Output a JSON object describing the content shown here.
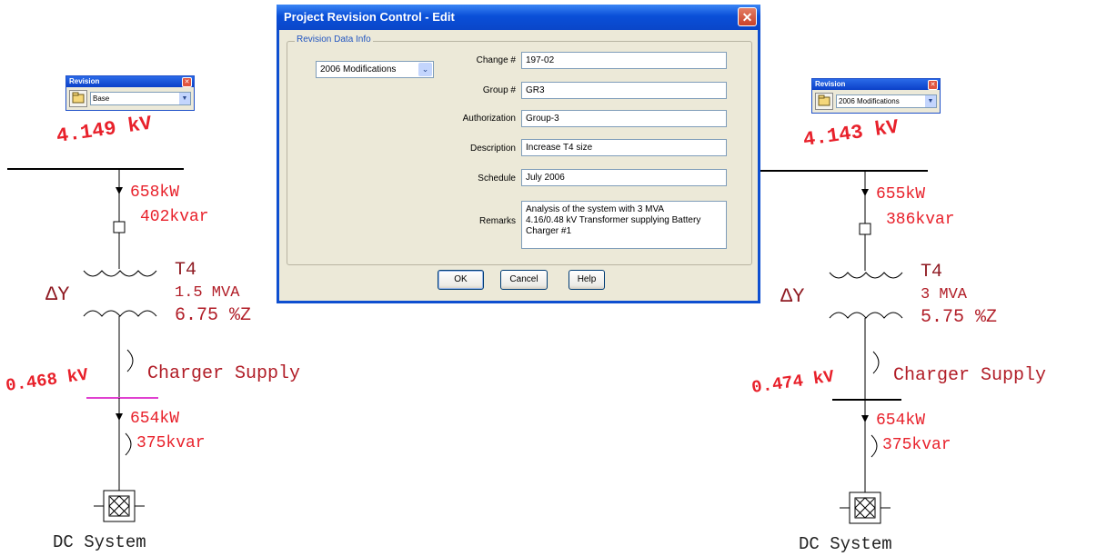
{
  "dialog": {
    "title": "Project Revision Control - Edit",
    "group_label": "Revision Data Info",
    "revision_select": "2006 Modifications",
    "fields": {
      "change": {
        "label": "Change #",
        "value": "197-02"
      },
      "group": {
        "label": "Group #",
        "value": "GR3"
      },
      "authorization": {
        "label": "Authorization",
        "value": "Group-3"
      },
      "description": {
        "label": "Description",
        "value": "Increase T4 size"
      },
      "schedule": {
        "label": "Schedule",
        "value": "July 2006"
      },
      "remarks": {
        "label": "Remarks",
        "value": "Analysis of the system with 3 MVA\n4.16/0.48 kV Transformer supplying Battery\nCharger #1"
      }
    },
    "buttons": {
      "ok": "OK",
      "cancel": "Cancel",
      "help": "Help"
    }
  },
  "left": {
    "toolbar": {
      "title": "Revision",
      "value": "Base"
    },
    "bus_voltage": "4.149 kV",
    "flow1_kw": "658kW",
    "flow1_kvar": "402kvar",
    "transformer": {
      "name": "T4",
      "rating": "1.5 MVA",
      "impedance": "6.75 %Z",
      "connection": "ΔY"
    },
    "bus2_voltage": "0.468 kV",
    "bus2_name": "Charger Supply",
    "flow2_kw": "654kW",
    "flow2_kvar": "375kvar",
    "load_name": "DC System"
  },
  "right": {
    "toolbar": {
      "title": "Revision",
      "value": "2006 Modifications"
    },
    "bus_voltage": "4.143 kV",
    "flow1_kw": "655kW",
    "flow1_kvar": "386kvar",
    "transformer": {
      "name": "T4",
      "rating": "3 MVA",
      "impedance": "5.75 %Z",
      "connection": "ΔY"
    },
    "bus2_voltage": "0.474 kV",
    "bus2_name": "Charger Supply",
    "flow2_kw": "654kW",
    "flow2_kvar": "375kvar",
    "load_name": "DC System"
  },
  "colors": {
    "value_red": "#e8212b",
    "label_red": "#b11d27",
    "bus_magenta": "#e040d0"
  }
}
